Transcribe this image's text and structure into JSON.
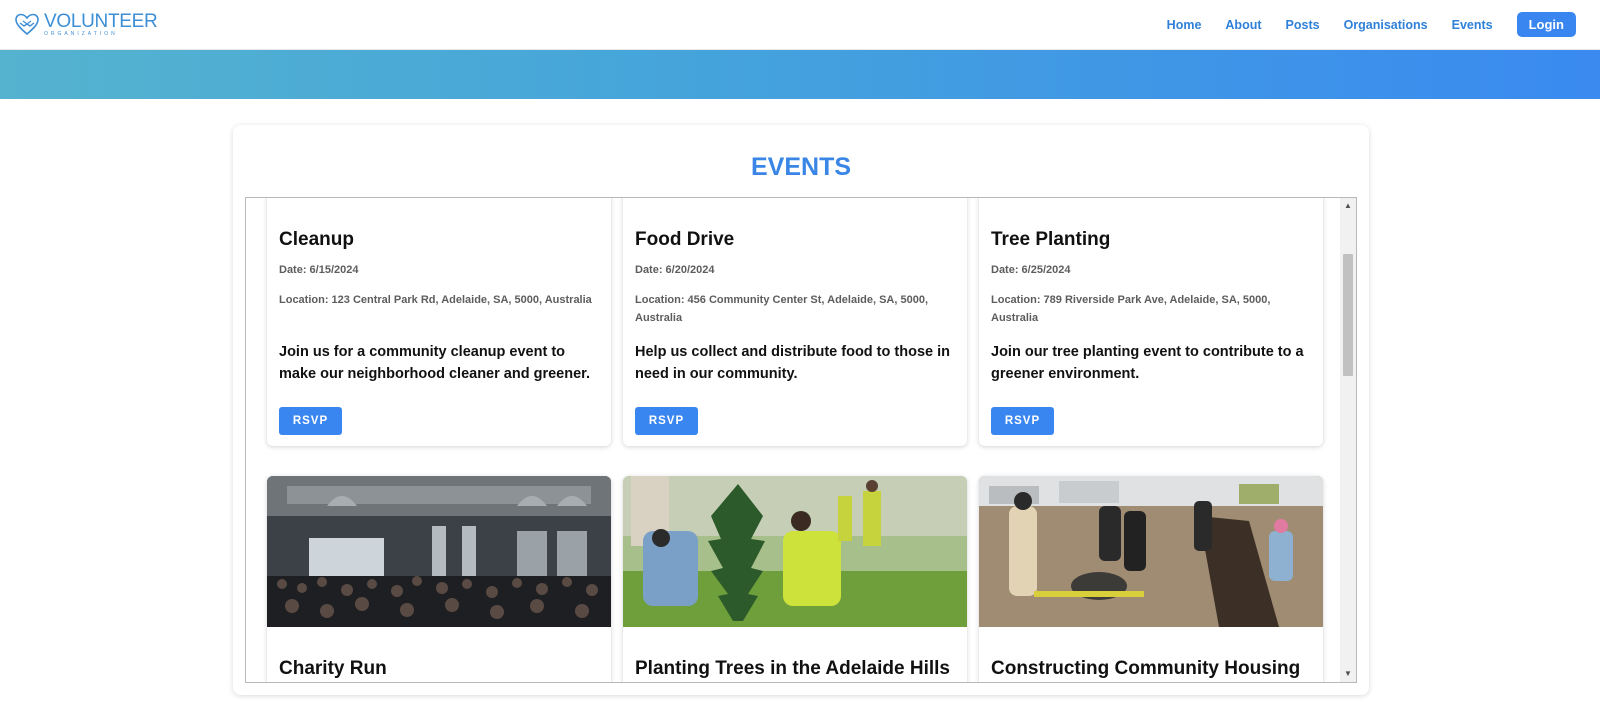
{
  "brand": {
    "title": "VOLUNTEER",
    "subtitle": "ORGANIZATION",
    "accent": "#3a86f0"
  },
  "nav": {
    "links": [
      "Home",
      "About",
      "Posts",
      "Organisations",
      "Events"
    ],
    "login": "Login"
  },
  "events_section": {
    "title": "EVENTS",
    "rsvp_label": "RSVP",
    "cards": [
      {
        "title": "Cleanup",
        "date": "Date: 6/15/2024",
        "location": "Location: 123 Central Park Rd, Adelaide, SA, 5000, Australia",
        "description": "Join us for a community cleanup event to make our neighborhood cleaner and greener."
      },
      {
        "title": "Food Drive",
        "date": "Date: 6/20/2024",
        "location": "Location: 456 Community Center St, Adelaide, SA, 5000, Australia",
        "description": "Help us collect and distribute food to those in need in our community."
      },
      {
        "title": "Tree Planting",
        "date": "Date: 6/25/2024",
        "location": "Location: 789 Riverside Park Ave, Adelaide, SA, 5000, Australia",
        "description": "Join our tree planting event to contribute to a greener environment."
      }
    ],
    "photo_cards": [
      {
        "title": "Charity Run",
        "image": "crowded-hall-photo"
      },
      {
        "title": "Planting Trees in the Adelaide Hills",
        "image": "tree-planting-photo"
      },
      {
        "title": "Constructing Community Housing",
        "image": "construction-volunteers-photo"
      }
    ]
  }
}
